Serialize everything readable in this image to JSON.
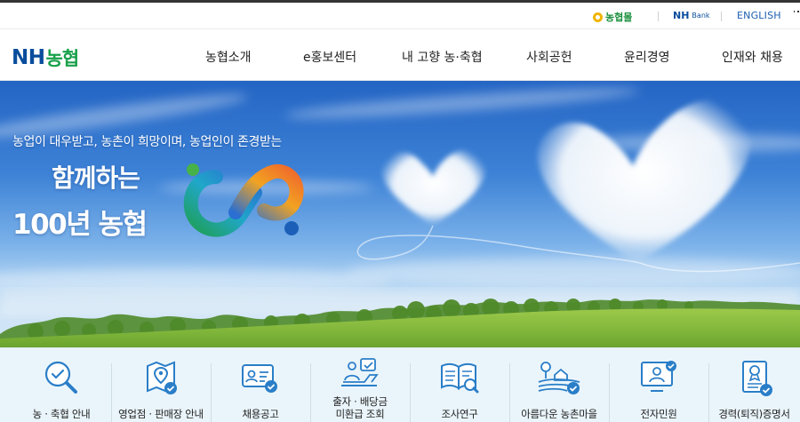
{
  "utility": {
    "nh_mall": "농협몰",
    "nh_bank": "NH",
    "nh_bank_suffix": "Bank",
    "english": "ENGLISH"
  },
  "header": {
    "logo_en": "NH",
    "logo_kr": "농협",
    "nav": [
      "농협소개",
      "e홍보센터",
      "내 고향 농·축협",
      "사회공헌",
      "윤리경영",
      "인재와 채용"
    ]
  },
  "hero": {
    "subtitle": "농업이 대우받고, 농촌이 희망이며, 농업인이 존경받는",
    "title_line1": "함께하는",
    "title_line2": "100년 농협"
  },
  "quick_menu": [
    {
      "label": "농 · 축협 안내",
      "icon": "magnifier-check-icon"
    },
    {
      "label": "영업점 · 판매장 안내",
      "icon": "map-pin-check-icon"
    },
    {
      "label": "채용공고",
      "icon": "id-card-check-icon"
    },
    {
      "label_line1": "출자 · 배당금",
      "label_line2": "미환급 조회",
      "icon": "laptop-check-icon"
    },
    {
      "label": "조사연구",
      "icon": "book-search-icon"
    },
    {
      "label": "아름다운 농촌마을",
      "icon": "farm-village-icon"
    },
    {
      "label": "전자민원",
      "icon": "monitor-person-icon"
    },
    {
      "label": "경력(퇴직)증명서",
      "icon": "certificate-check-icon"
    }
  ],
  "colors": {
    "brand_blue": "#0a4d9c",
    "brand_green": "#19a04b",
    "icon_blue": "#2a7ec8",
    "quick_bg": "#eaf5fb"
  }
}
